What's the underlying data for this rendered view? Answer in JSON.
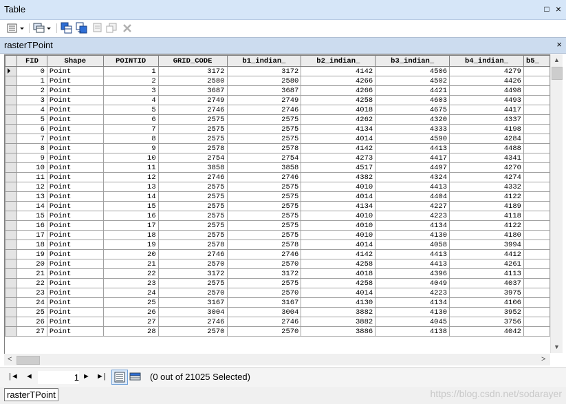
{
  "window": {
    "title": "Table",
    "restore_symbol": "□",
    "close_symbol": "×"
  },
  "toolbar": {
    "icons": [
      "table-options-icon",
      "related-tables-icon",
      "select-by-attributes-icon",
      "switch-selection-icon",
      "clear-selection-icon",
      "zoom-to-selected-icon",
      "delete-selected-icon"
    ]
  },
  "tab": {
    "title": "rasterTPoint",
    "close_symbol": "×"
  },
  "table": {
    "columns": [
      "FID",
      "Shape",
      "POINTID",
      "GRID_CODE",
      "b1_indian_",
      "b2_indian_",
      "b3_indian_",
      "b4_indian_",
      "b5_"
    ],
    "rows": [
      [
        "0",
        "Point",
        "1",
        "3172",
        "3172",
        "4142",
        "4506",
        "4279",
        ""
      ],
      [
        "1",
        "Point",
        "2",
        "2580",
        "2580",
        "4266",
        "4502",
        "4426",
        ""
      ],
      [
        "2",
        "Point",
        "3",
        "3687",
        "3687",
        "4266",
        "4421",
        "4498",
        ""
      ],
      [
        "3",
        "Point",
        "4",
        "2749",
        "2749",
        "4258",
        "4603",
        "4493",
        ""
      ],
      [
        "4",
        "Point",
        "5",
        "2746",
        "2746",
        "4018",
        "4675",
        "4417",
        ""
      ],
      [
        "5",
        "Point",
        "6",
        "2575",
        "2575",
        "4262",
        "4320",
        "4337",
        ""
      ],
      [
        "6",
        "Point",
        "7",
        "2575",
        "2575",
        "4134",
        "4333",
        "4198",
        ""
      ],
      [
        "7",
        "Point",
        "8",
        "2575",
        "2575",
        "4014",
        "4590",
        "4284",
        ""
      ],
      [
        "8",
        "Point",
        "9",
        "2578",
        "2578",
        "4142",
        "4413",
        "4488",
        ""
      ],
      [
        "9",
        "Point",
        "10",
        "2754",
        "2754",
        "4273",
        "4417",
        "4341",
        ""
      ],
      [
        "10",
        "Point",
        "11",
        "3858",
        "3858",
        "4517",
        "4497",
        "4270",
        ""
      ],
      [
        "11",
        "Point",
        "12",
        "2746",
        "2746",
        "4382",
        "4324",
        "4274",
        ""
      ],
      [
        "12",
        "Point",
        "13",
        "2575",
        "2575",
        "4010",
        "4413",
        "4332",
        ""
      ],
      [
        "13",
        "Point",
        "14",
        "2575",
        "2575",
        "4014",
        "4404",
        "4122",
        ""
      ],
      [
        "14",
        "Point",
        "15",
        "2575",
        "2575",
        "4134",
        "4227",
        "4189",
        ""
      ],
      [
        "15",
        "Point",
        "16",
        "2575",
        "2575",
        "4010",
        "4223",
        "4118",
        ""
      ],
      [
        "16",
        "Point",
        "17",
        "2575",
        "2575",
        "4010",
        "4134",
        "4122",
        ""
      ],
      [
        "17",
        "Point",
        "18",
        "2575",
        "2575",
        "4010",
        "4130",
        "4180",
        ""
      ],
      [
        "18",
        "Point",
        "19",
        "2578",
        "2578",
        "4014",
        "4058",
        "3994",
        ""
      ],
      [
        "19",
        "Point",
        "20",
        "2746",
        "2746",
        "4142",
        "4413",
        "4412",
        ""
      ],
      [
        "20",
        "Point",
        "21",
        "2570",
        "2570",
        "4258",
        "4413",
        "4261",
        ""
      ],
      [
        "21",
        "Point",
        "22",
        "3172",
        "3172",
        "4018",
        "4396",
        "4113",
        ""
      ],
      [
        "22",
        "Point",
        "23",
        "2575",
        "2575",
        "4258",
        "4049",
        "4037",
        ""
      ],
      [
        "23",
        "Point",
        "24",
        "2570",
        "2570",
        "4014",
        "4223",
        "3975",
        ""
      ],
      [
        "24",
        "Point",
        "25",
        "3167",
        "3167",
        "4130",
        "4134",
        "4106",
        ""
      ],
      [
        "25",
        "Point",
        "26",
        "3004",
        "3004",
        "3882",
        "4130",
        "3952",
        ""
      ],
      [
        "26",
        "Point",
        "27",
        "2746",
        "2746",
        "3882",
        "4045",
        "3756",
        ""
      ],
      [
        "27",
        "Point",
        "28",
        "2570",
        "2570",
        "3886",
        "4138",
        "4042",
        ""
      ]
    ]
  },
  "scroll": {
    "up": "▲",
    "down": "▼",
    "left": "<",
    "right": ">"
  },
  "nav": {
    "first": "|◄",
    "prev": "◄",
    "record": "1",
    "next": "►",
    "last": "►|",
    "status": "(0 out of 21025 Selected)"
  },
  "bottom": {
    "tab_label": "rasterTPoint",
    "watermark": "https://blog.csdn.net/sodarayer"
  }
}
